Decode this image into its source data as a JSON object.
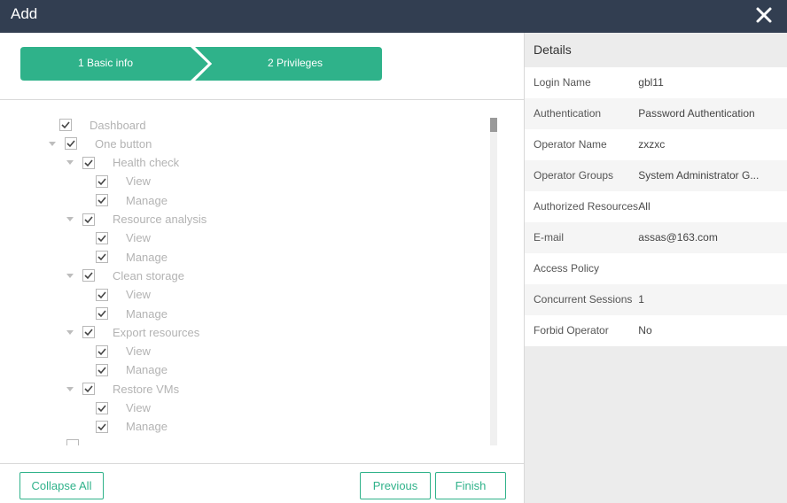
{
  "window": {
    "title": "Add"
  },
  "steps": [
    {
      "label": "1 Basic info"
    },
    {
      "label": "2 Privileges"
    }
  ],
  "tree": [
    {
      "label": "Dashboard",
      "level": 0,
      "caret": false
    },
    {
      "label": "One button",
      "level": 0,
      "caret": true
    },
    {
      "label": "Health check",
      "level": 1,
      "caret": true
    },
    {
      "label": "View",
      "level": 2,
      "caret": false
    },
    {
      "label": "Manage",
      "level": 2,
      "caret": false
    },
    {
      "label": "Resource analysis",
      "level": 1,
      "caret": true
    },
    {
      "label": "View",
      "level": 2,
      "caret": false
    },
    {
      "label": "Manage",
      "level": 2,
      "caret": false
    },
    {
      "label": "Clean storage",
      "level": 1,
      "caret": true
    },
    {
      "label": "View",
      "level": 2,
      "caret": false
    },
    {
      "label": "Manage",
      "level": 2,
      "caret": false
    },
    {
      "label": "Export resources",
      "level": 1,
      "caret": true
    },
    {
      "label": "View",
      "level": 2,
      "caret": false
    },
    {
      "label": "Manage",
      "level": 2,
      "caret": false
    },
    {
      "label": "Restore VMs",
      "level": 1,
      "caret": true
    },
    {
      "label": "View",
      "level": 2,
      "caret": false
    },
    {
      "label": "Manage",
      "level": 2,
      "caret": false
    },
    {
      "label": "",
      "level": 1,
      "caret": false
    }
  ],
  "buttons": {
    "collapse_all": "Collapse All",
    "previous": "Previous",
    "finish": "Finish"
  },
  "details": {
    "title": "Details",
    "rows": [
      {
        "key": "Login Name",
        "value": "gbl11"
      },
      {
        "key": "Authentication",
        "value": "Password Authentication"
      },
      {
        "key": "Operator Name",
        "value": "zxzxc"
      },
      {
        "key": "Operator Groups",
        "value": "System Administrator G..."
      },
      {
        "key": "Authorized Resources",
        "value": "All"
      },
      {
        "key": "E-mail",
        "value": "assas@163.com"
      },
      {
        "key": "Access Policy",
        "value": ""
      },
      {
        "key": "Concurrent Sessions",
        "value": "1"
      },
      {
        "key": "Forbid Operator",
        "value": "No"
      }
    ]
  },
  "colors": {
    "accent": "#2fb28a",
    "titlebar": "#323e51"
  }
}
